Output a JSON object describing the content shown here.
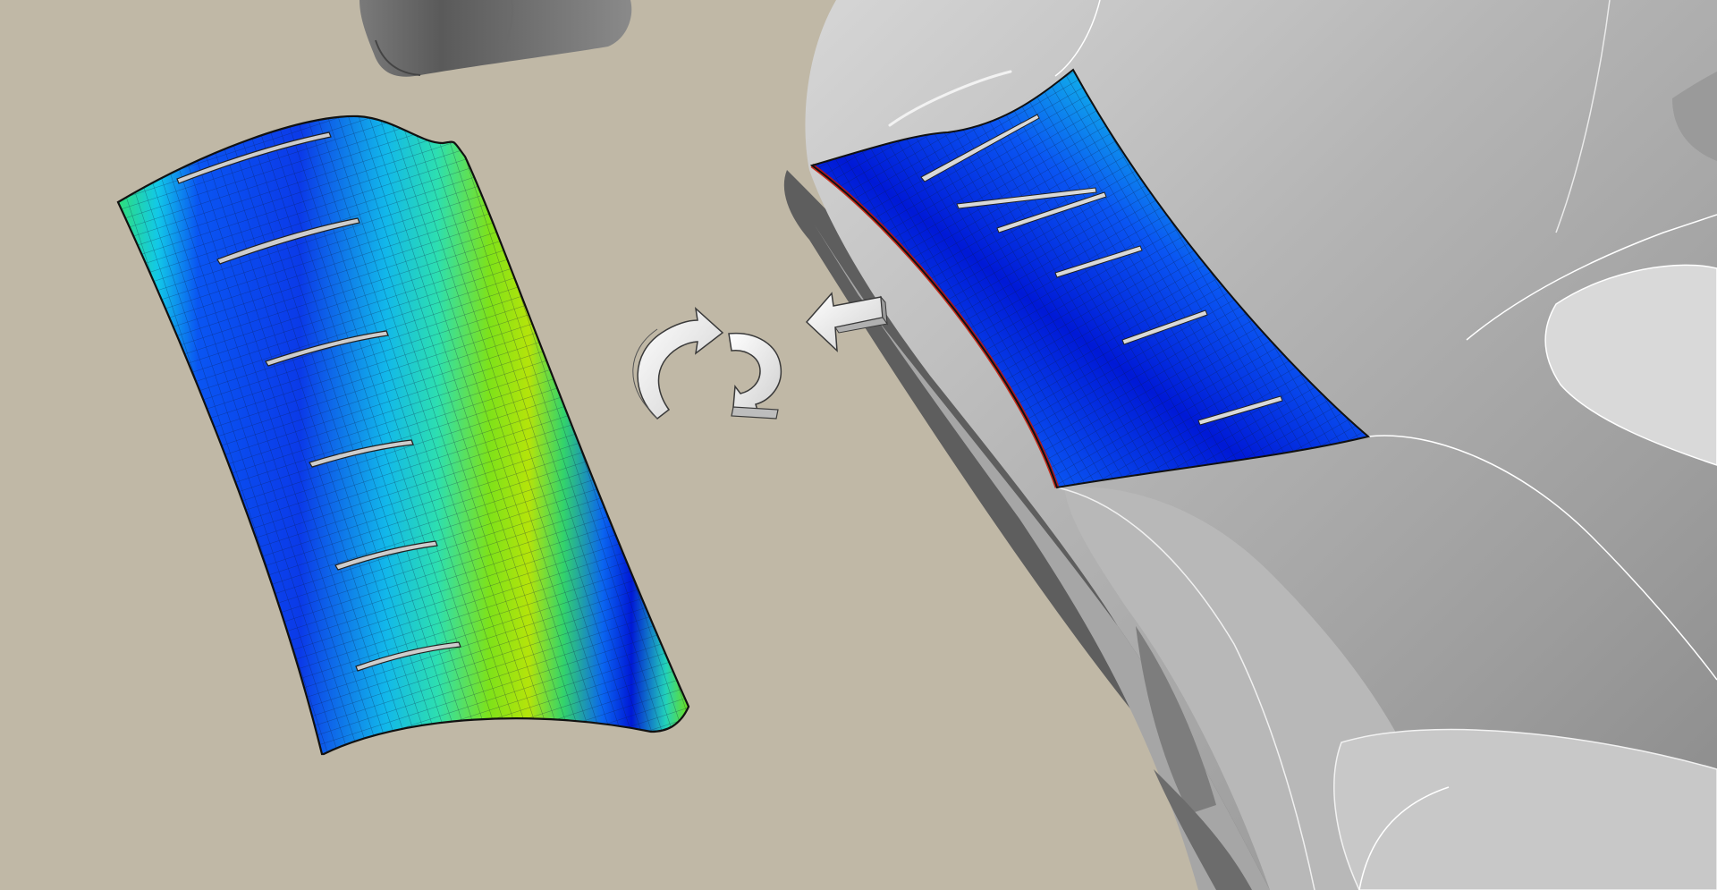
{
  "viewport": {
    "background": "#c0b8a6",
    "body_color": "#bdbdbd",
    "shadow_color": "#5e5e5e"
  },
  "flattened_panel": {
    "slots": 6,
    "grid_color": "#0a1a40",
    "colormap": [
      "#0019d6",
      "#0a55f2",
      "#12c8e8",
      "#2ddfb0",
      "#55e22e",
      "#a8e40a",
      "#ffd800",
      "#ff5a00",
      "#c81400"
    ]
  },
  "mounted_panel": {
    "slots": 6,
    "edge_highlight": "#ff5a00"
  },
  "icons": {
    "rotate_icon": "rotate-arrows-icon",
    "move_icon": "move-arrow-icon"
  }
}
